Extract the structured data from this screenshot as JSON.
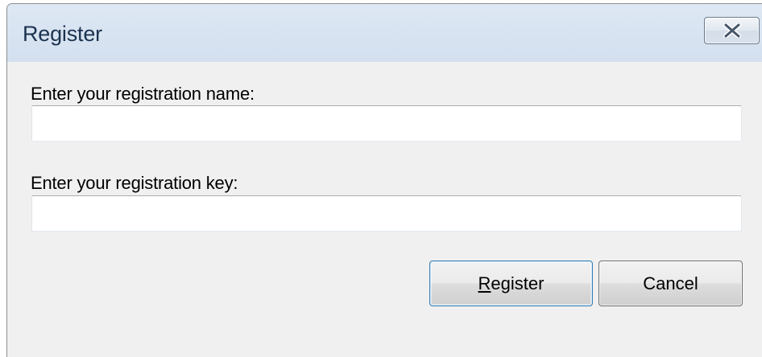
{
  "dialog": {
    "title": "Register",
    "close_icon": "close-icon"
  },
  "form": {
    "name_label": "Enter your registration name:",
    "name_value": "",
    "key_label": "Enter your registration key:",
    "key_value": ""
  },
  "buttons": {
    "register_mnemonic": "R",
    "register_rest": "egister",
    "cancel_label": "Cancel"
  },
  "colors": {
    "title_bar": "#d8e4f1",
    "dialog_bg": "#f0f0f0",
    "default_button_border": "#3c7fb1"
  }
}
